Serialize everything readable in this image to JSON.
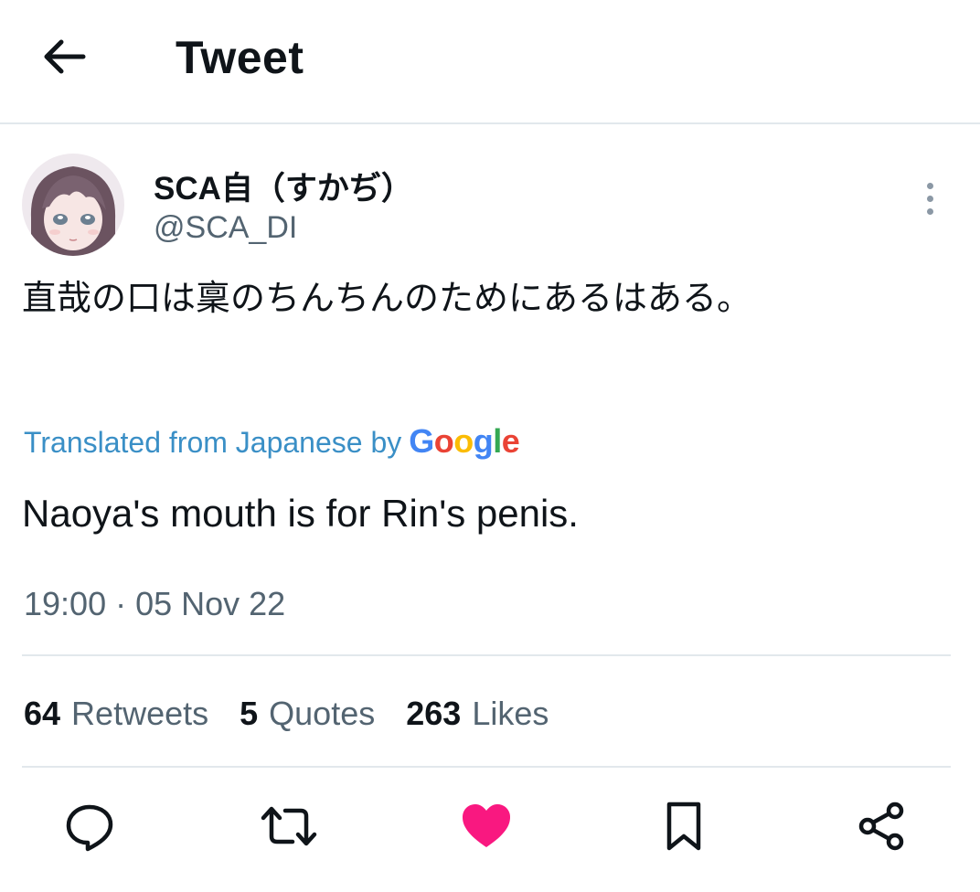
{
  "header": {
    "title": "Tweet"
  },
  "author": {
    "display_name": "SCA自（すかぢ）",
    "handle": "@SCA_DI"
  },
  "tweet": {
    "text": "直哉の口は稟のちんちんのためにあるはある。",
    "translated_label": "Translated from Japanese by",
    "translator_brand": "Google",
    "translation": "Naoya's mouth is for Rin's penis.",
    "timestamp": "19:00 · 05 Nov 22"
  },
  "stats": {
    "retweets": {
      "count": "64",
      "label": "Retweets"
    },
    "quotes": {
      "count": "5",
      "label": "Quotes"
    },
    "likes": {
      "count": "263",
      "label": "Likes"
    }
  },
  "actions": [
    "reply-icon",
    "retweet-icon",
    "like-icon",
    "bookmark-icon",
    "share-icon"
  ],
  "colors": {
    "like": "#f91880",
    "link": "#3a8fc6",
    "secondary_text": "#536471",
    "divider": "#e2e8ec",
    "google_blue": "#4285f4",
    "google_red": "#ea4335",
    "google_yellow": "#fbbc05",
    "google_green": "#34a853"
  }
}
